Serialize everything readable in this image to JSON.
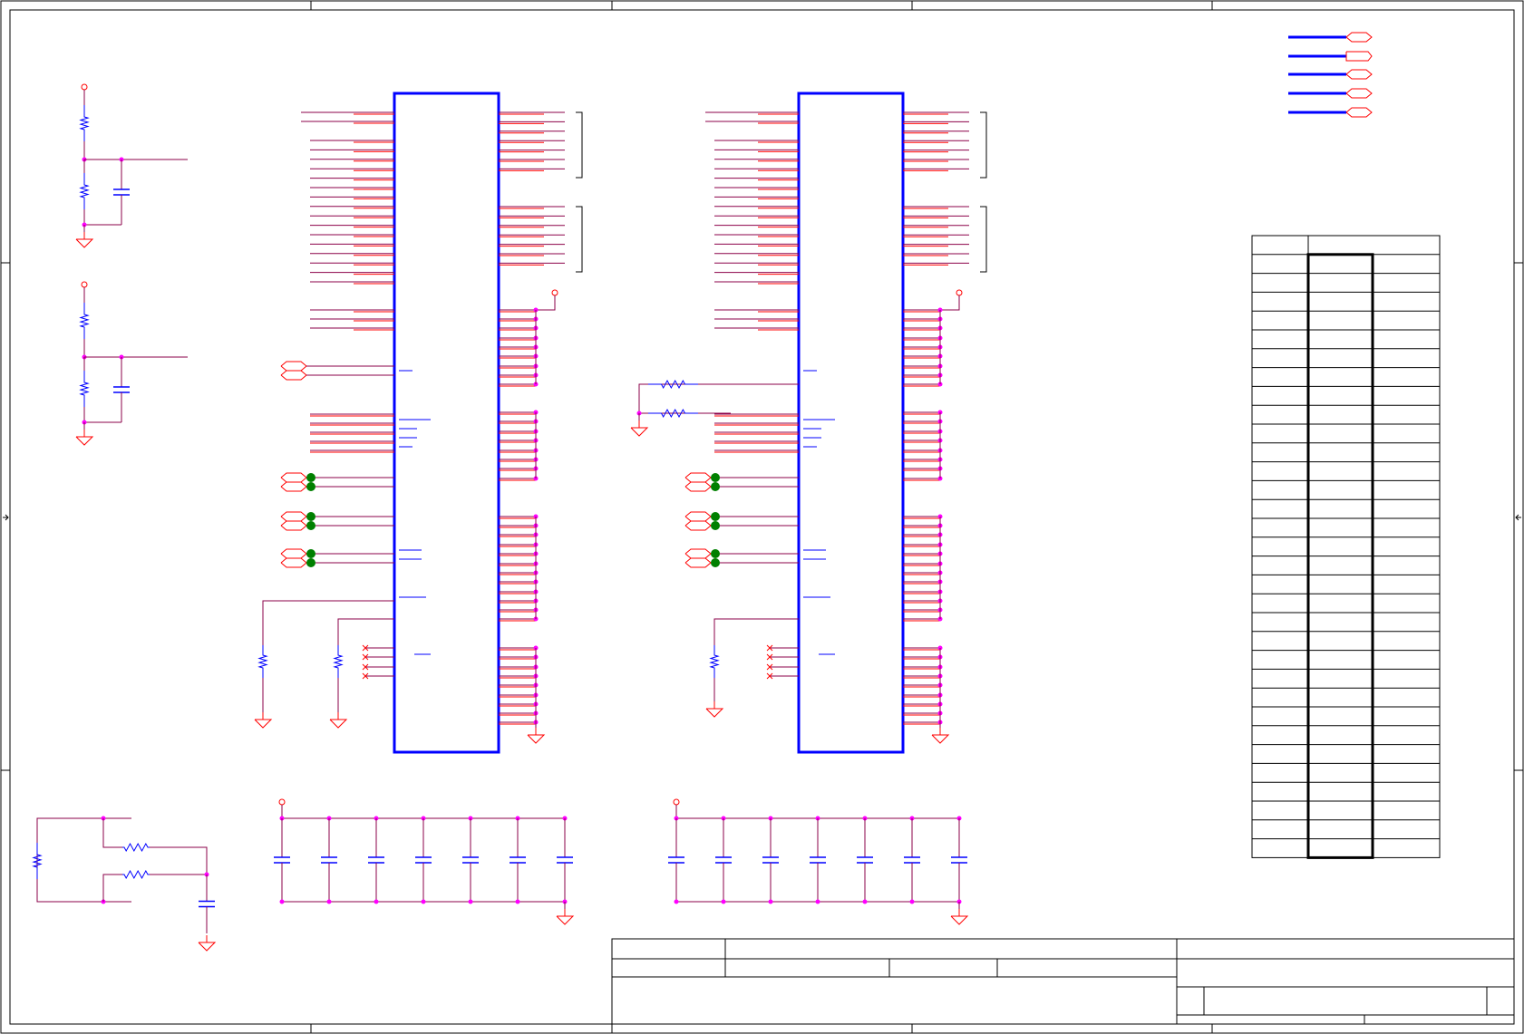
{
  "sheet": {
    "background": "#ffffff",
    "border_color": "#000000",
    "zones": 5,
    "rows": 4
  },
  "palette": {
    "wire": "#8b0048",
    "pin_red": "#ff0000",
    "ic_body": "#0000ff",
    "junction": "#ff00ff",
    "test_point": "#008000",
    "net_port": "#0000ff",
    "ground": "#ff0000"
  },
  "title_block": {
    "title": "",
    "size": "",
    "document_number": "",
    "revision": "",
    "date": "",
    "sheet": ""
  },
  "pin_map_table": {
    "rows": 33,
    "columns": 3
  },
  "icons": [
    "ground-symbol",
    "resistor-symbol",
    "capacitor-symbol",
    "power-port-symbol",
    "test-point-symbol",
    "off-page-connector-symbol"
  ]
}
